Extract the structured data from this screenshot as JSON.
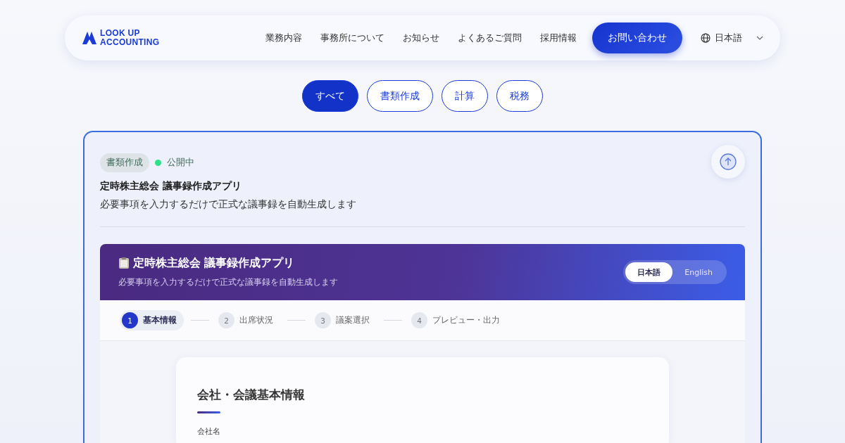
{
  "header": {
    "logo": {
      "line_1": "LOOK UP",
      "line_2": "ACCOUNTING"
    },
    "nav": [
      "業務内容",
      "事務所について",
      "お知らせ",
      "よくあるご質問",
      "採用情報"
    ],
    "contact_button": "お問い合わせ",
    "language": "日本語"
  },
  "filters": [
    {
      "label": "すべて",
      "selected": true
    },
    {
      "label": "書類作成",
      "selected": false
    },
    {
      "label": "計算",
      "selected": false
    },
    {
      "label": "税務",
      "selected": false
    }
  ],
  "card": {
    "tag": "書類作成",
    "status": "公開中",
    "title": "定時株主総会 議事録作成アプリ",
    "description": "必要事項を入力するだけで正式な議事録を自動生成します",
    "app": {
      "title": "定時株主総会 議事録作成アプリ",
      "subtitle": "必要事項を入力するだけで正式な議事録を自動生成します",
      "languages": [
        {
          "label": "日本語",
          "selected": true
        },
        {
          "label": "English",
          "selected": false
        }
      ],
      "steps": [
        {
          "number": "1",
          "label": "基本情報",
          "selected": true
        },
        {
          "number": "2",
          "label": "出席状況",
          "selected": false
        },
        {
          "number": "3",
          "label": "議案選択",
          "selected": false
        },
        {
          "number": "4",
          "label": "プレビュー・出力",
          "selected": false
        }
      ],
      "form": {
        "heading": "会社・会議基本情報",
        "field_label": "会社名"
      }
    }
  }
}
